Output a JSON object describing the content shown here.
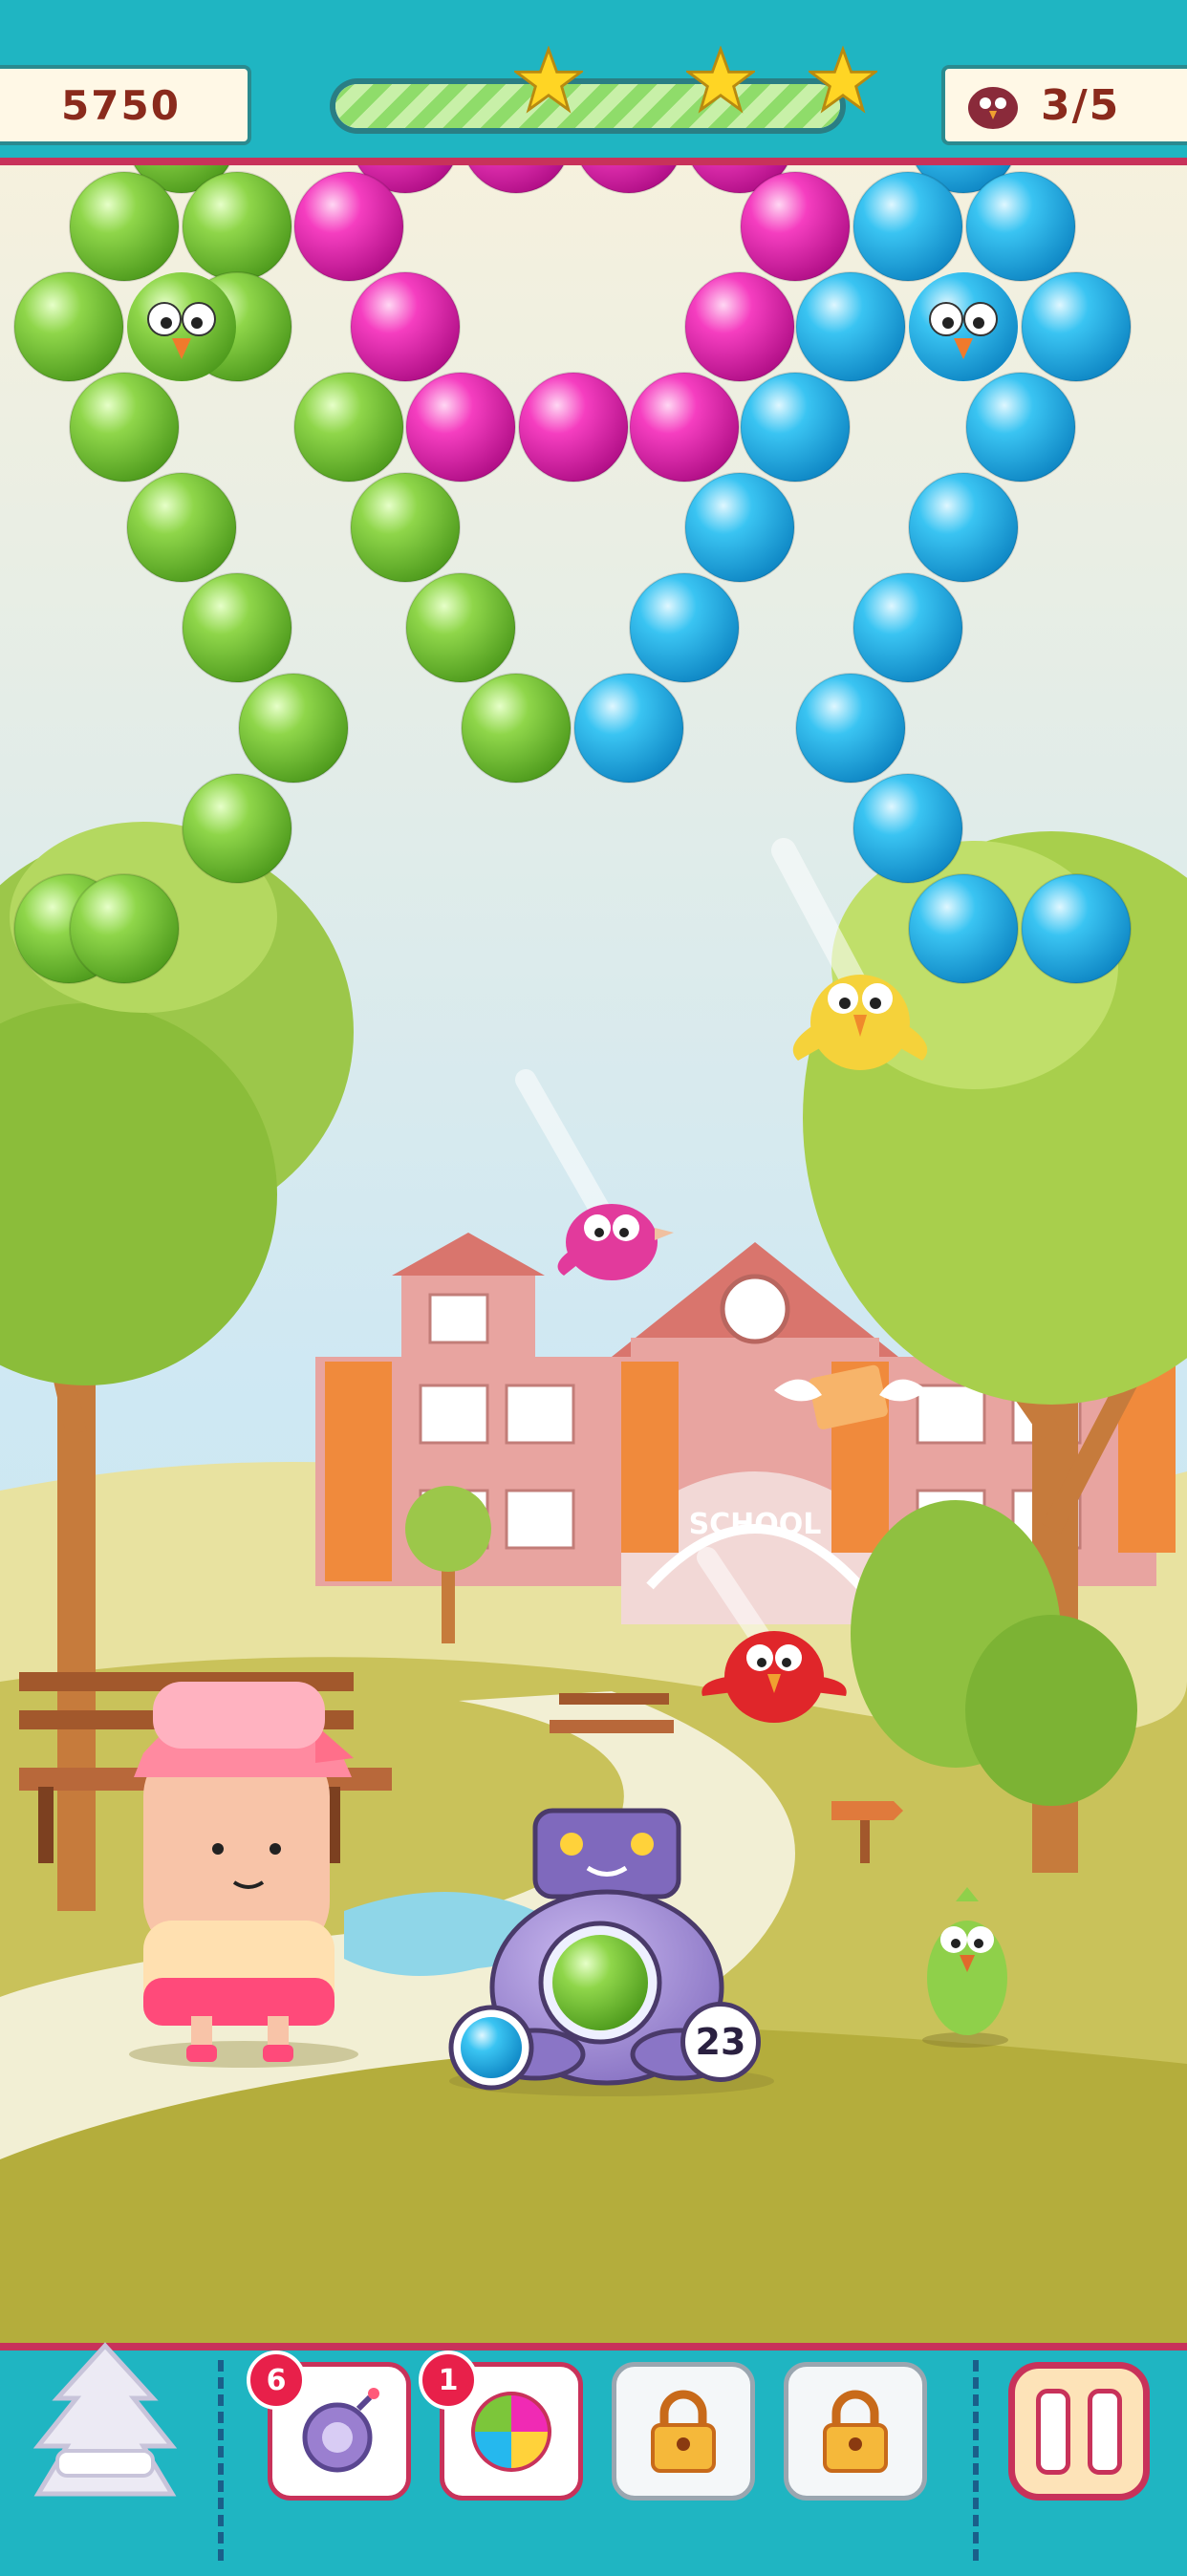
{
  "game": {
    "score": "5750",
    "stars": {
      "earned": 3,
      "total": 3
    },
    "level_progress": 1.0,
    "birds_rescued": "3/5",
    "shots_remaining": "23",
    "current_bubble": "green",
    "next_bubble": "blue",
    "scene": {
      "building_sign": "SCHOOL"
    }
  },
  "bubble_colors": {
    "green": "#7cc63a",
    "pink": "#f02ab4",
    "blue": "#25b8ee"
  },
  "bubbles": {
    "green": [
      [
        190,
        145
      ],
      [
        130,
        237
      ],
      [
        248,
        237
      ],
      [
        72,
        342
      ],
      [
        248,
        342
      ],
      [
        130,
        447
      ],
      [
        365,
        447
      ],
      [
        190,
        552
      ],
      [
        424,
        552
      ],
      [
        248,
        657
      ],
      [
        482,
        657
      ],
      [
        307,
        762
      ],
      [
        540,
        762
      ],
      [
        248,
        867
      ],
      [
        72,
        972
      ],
      [
        130,
        972
      ]
    ],
    "pink": [
      [
        424,
        145
      ],
      [
        540,
        145
      ],
      [
        658,
        145
      ],
      [
        774,
        145
      ],
      [
        365,
        237
      ],
      [
        832,
        237
      ],
      [
        424,
        342
      ],
      [
        774,
        342
      ],
      [
        482,
        447
      ],
      [
        600,
        447
      ],
      [
        716,
        447
      ]
    ],
    "blue": [
      [
        1008,
        145
      ],
      [
        950,
        237
      ],
      [
        1068,
        237
      ],
      [
        890,
        342
      ],
      [
        1126,
        342
      ],
      [
        832,
        447
      ],
      [
        1068,
        447
      ],
      [
        774,
        552
      ],
      [
        1008,
        552
      ],
      [
        716,
        657
      ],
      [
        950,
        657
      ],
      [
        658,
        762
      ],
      [
        890,
        762
      ],
      [
        950,
        867
      ],
      [
        1008,
        972
      ],
      [
        1126,
        972
      ]
    ],
    "trapped_birds": [
      {
        "color": "green",
        "pos": [
          190,
          342
        ]
      },
      {
        "color": "blue",
        "pos": [
          1008,
          342
        ]
      }
    ]
  },
  "boosters": [
    {
      "name": "bomb",
      "count": "6",
      "locked": false
    },
    {
      "name": "rainbow",
      "count": "1",
      "locked": false
    },
    {
      "name": "locked-slot",
      "locked": true
    },
    {
      "name": "locked-slot",
      "locked": true
    }
  ]
}
